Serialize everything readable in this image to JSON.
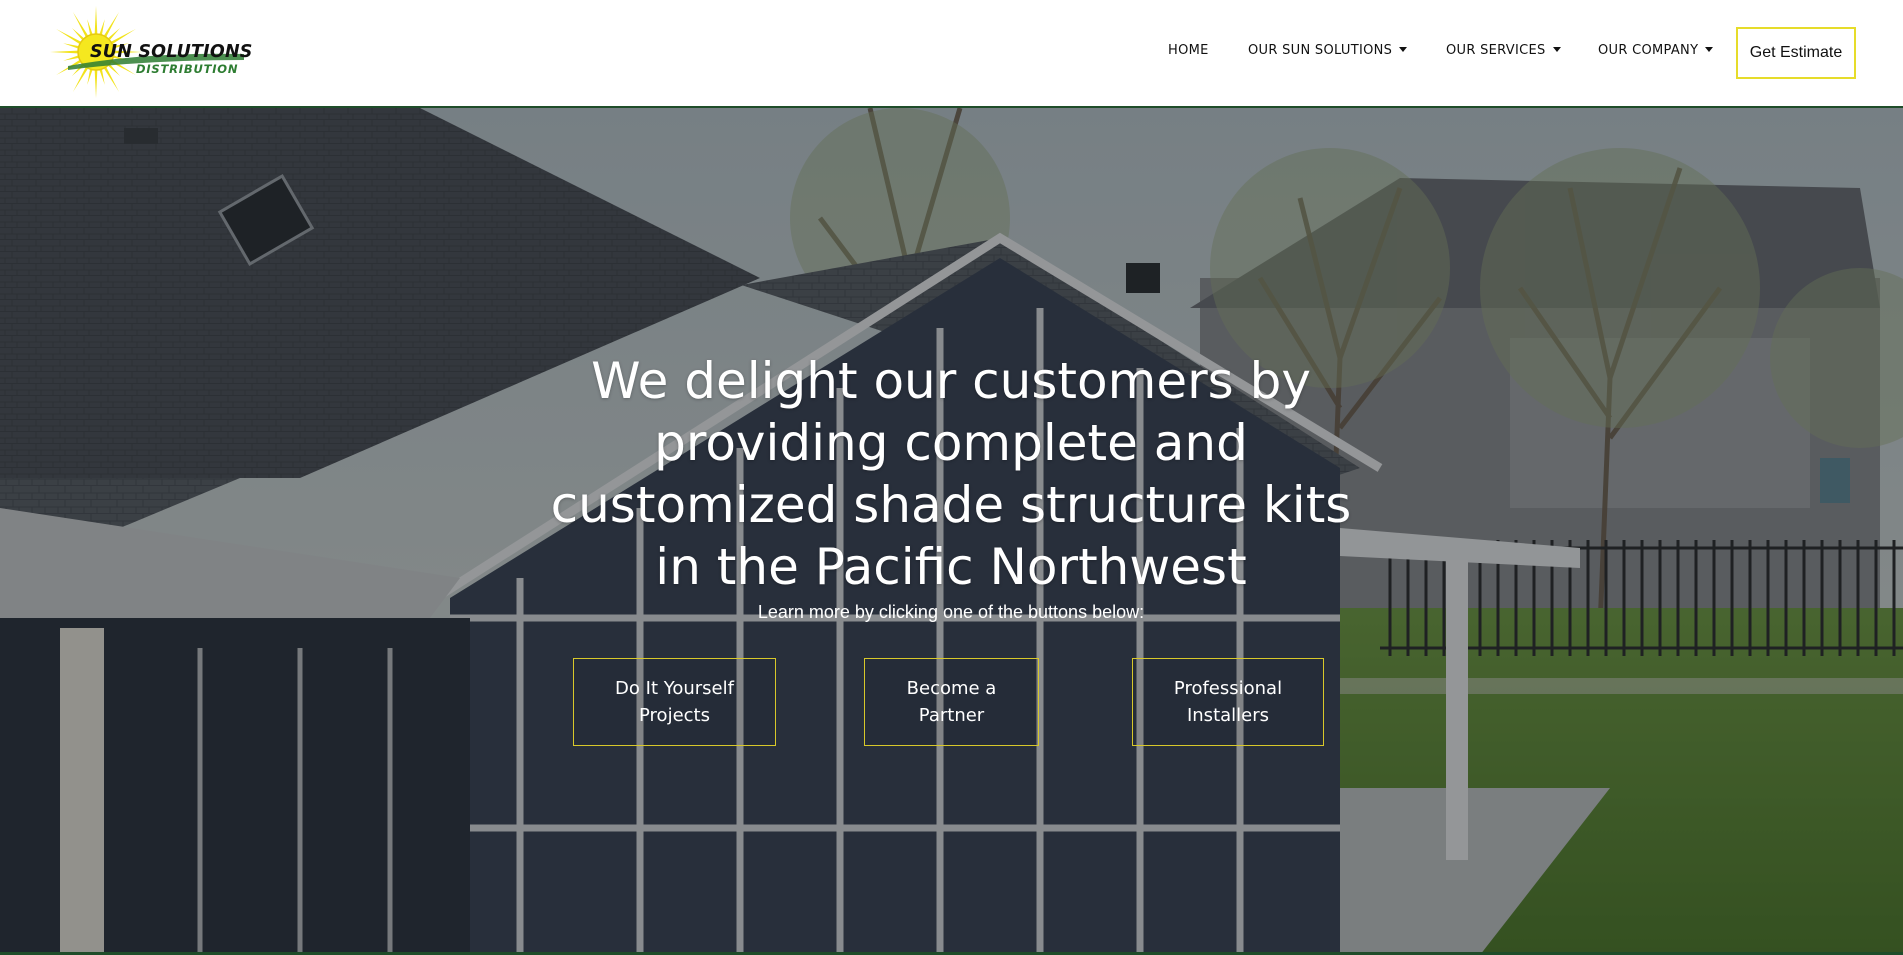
{
  "brand": {
    "name_line1": "SUN SOLUTIONS",
    "name_line2": "DISTRIBUTION",
    "colors": {
      "sun_yellow": "#f2e31b",
      "brand_green": "#2e7d32",
      "dark_green_rule": "#1f4d2a",
      "button_border": "#d8c82a"
    }
  },
  "nav": {
    "items": [
      {
        "label": "HOME",
        "has_dropdown": false
      },
      {
        "label": "OUR SUN SOLUTIONS",
        "has_dropdown": true
      },
      {
        "label": "OUR SERVICES",
        "has_dropdown": true
      },
      {
        "label": "OUR COMPANY",
        "has_dropdown": true
      }
    ],
    "cta_label": "Get Estimate"
  },
  "hero": {
    "title": "We delight our customers by providing complete and customized shade structure kits in the Pacific Northwest",
    "subtitle": "Learn more by clicking one of the buttons below:",
    "buttons": [
      {
        "label_line1": "Do It Yourself",
        "label_line2": "Projects"
      },
      {
        "label_line1": "Become a",
        "label_line2": "Partner"
      },
      {
        "label_line1": "Professional",
        "label_line2": "Installers"
      }
    ]
  },
  "icons": {
    "logo": "sun-burst-logo",
    "dropdown": "caret-down-icon"
  }
}
